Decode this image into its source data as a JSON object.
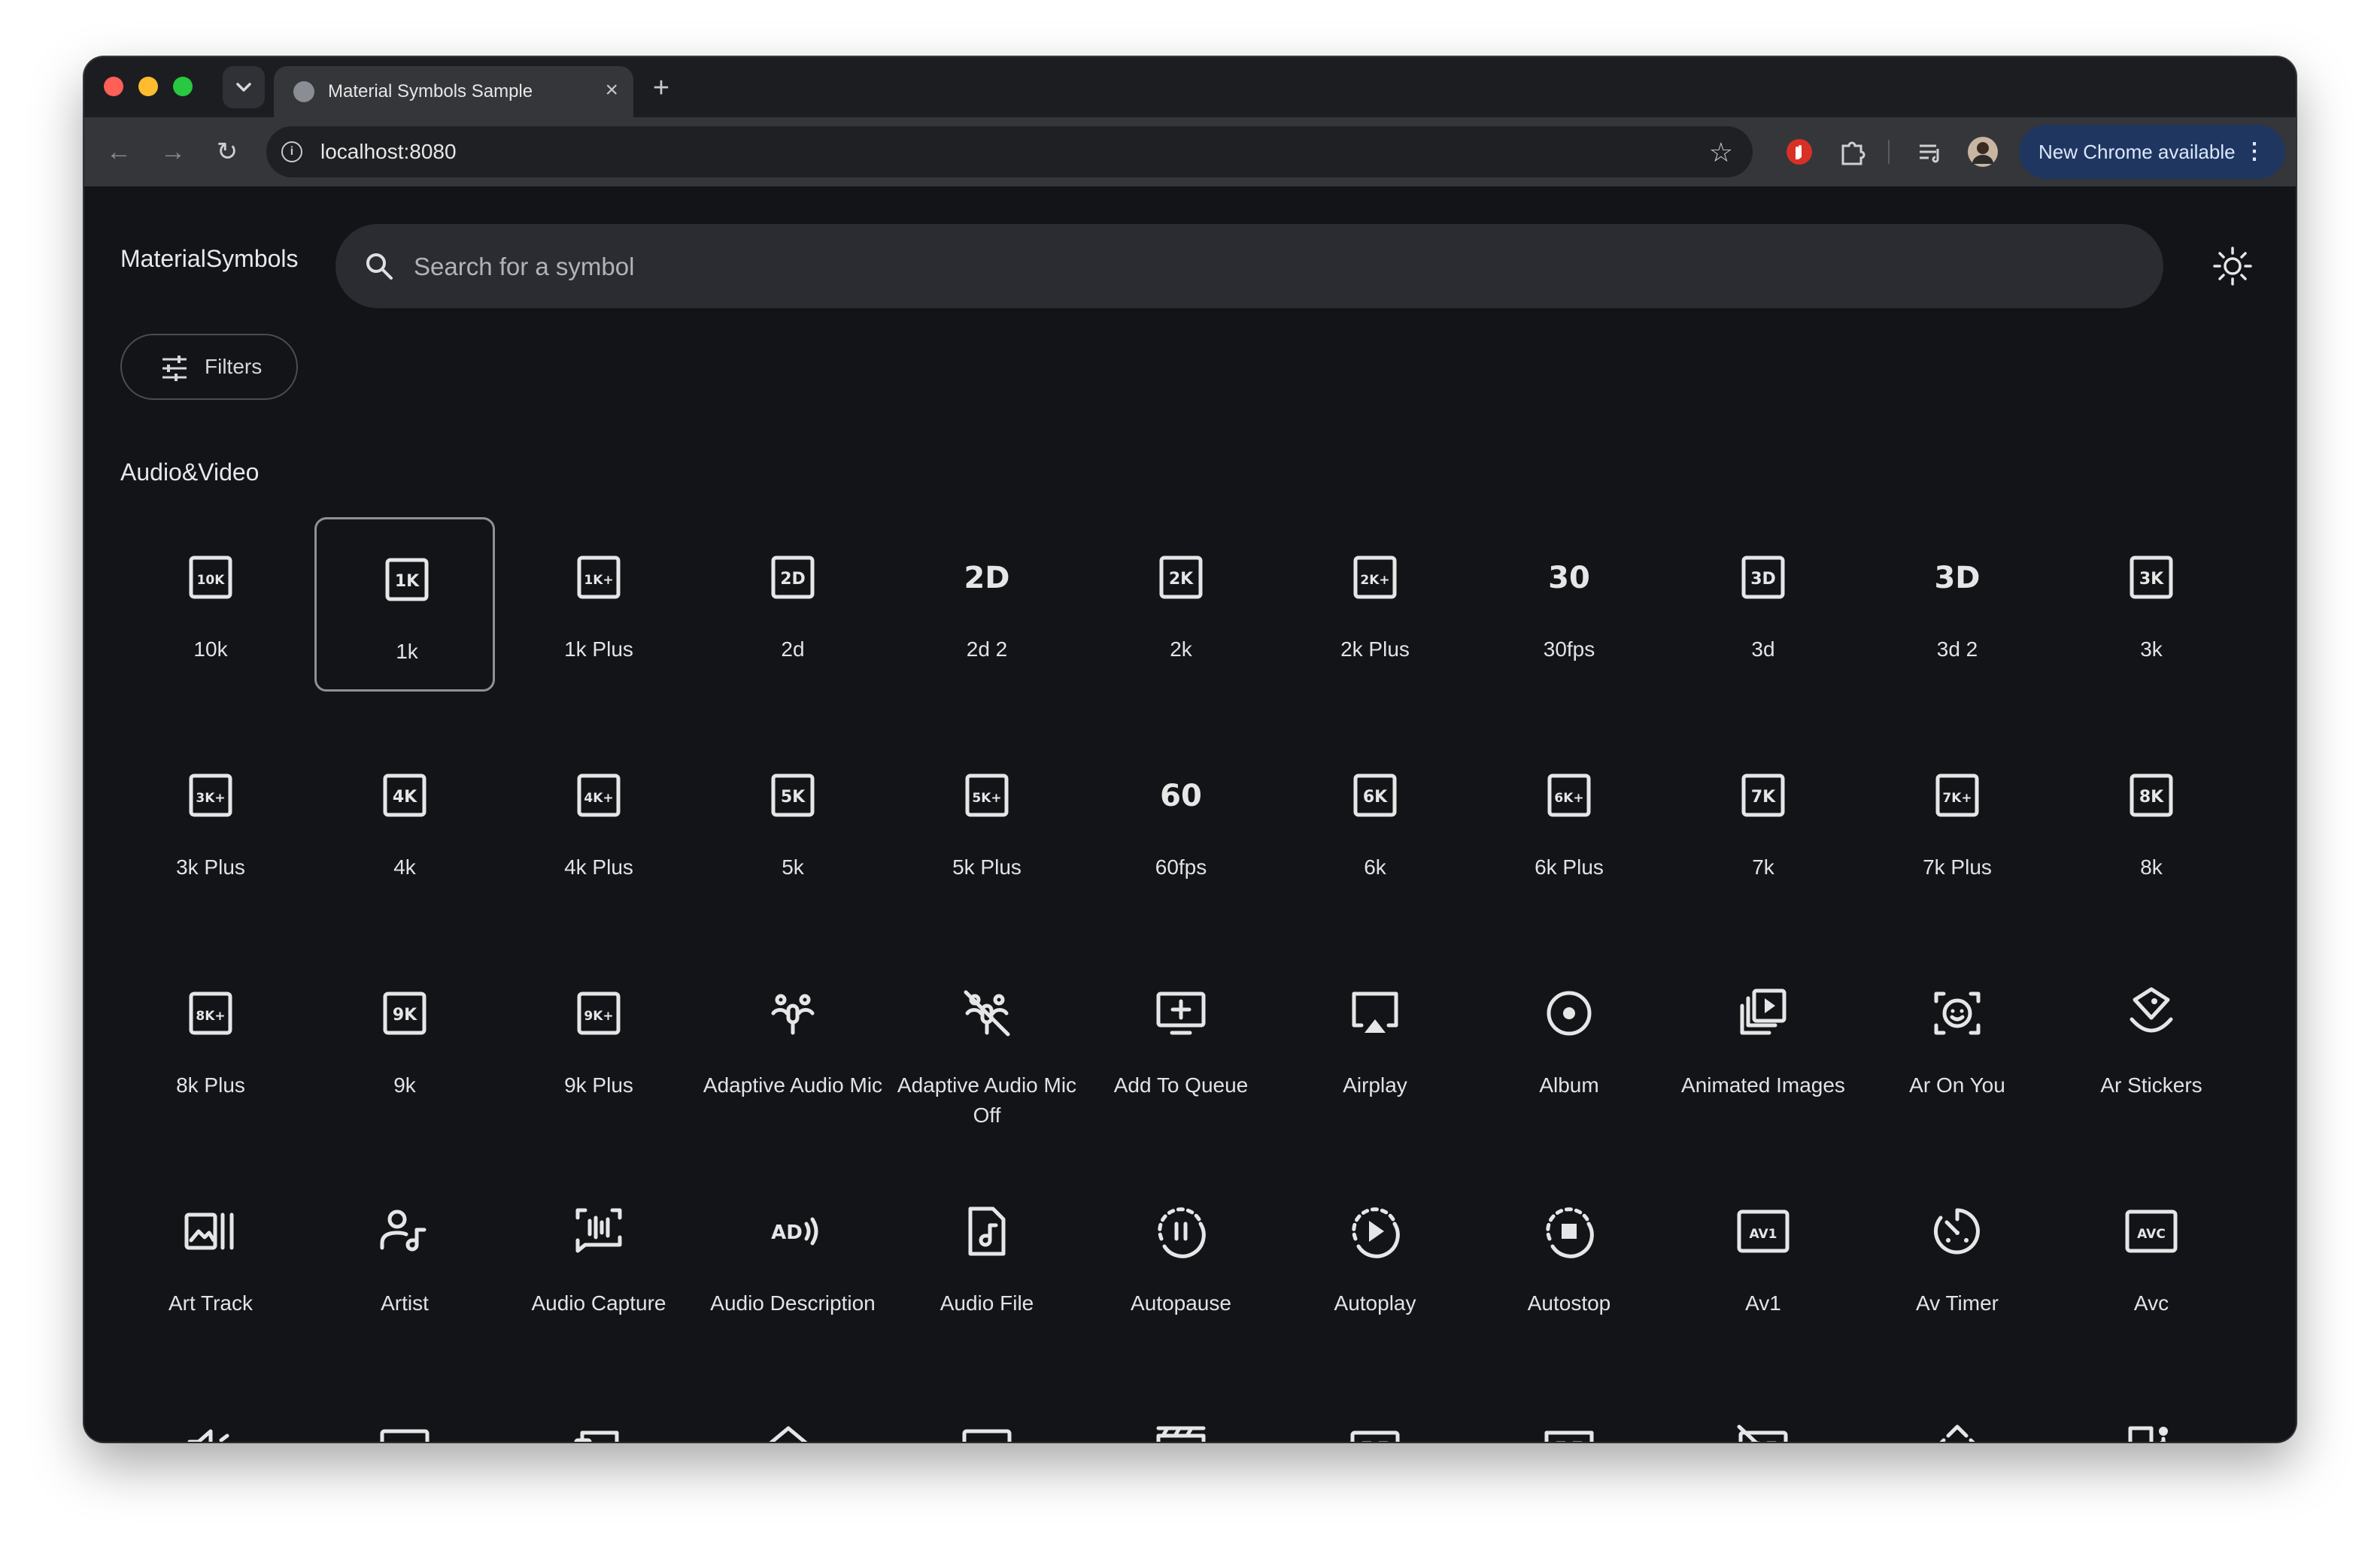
{
  "browser": {
    "tab_title": "Material Symbols Sample",
    "tab_close": "×",
    "new_tab": "+",
    "url": "localhost:8080",
    "update_label": "New Chrome available",
    "update_menu": "⋮",
    "nav_back": "←",
    "nav_forward": "→",
    "nav_reload": "↻",
    "bookmark_star": "☆"
  },
  "app": {
    "brand": "MaterialSymbols",
    "search_placeholder": "Search for a symbol",
    "filters_label": "Filters",
    "section_title": "Audio&Video",
    "selected_icon": "1k"
  },
  "icons": [
    {
      "label": "10k",
      "glyph": "10K",
      "kind": "box"
    },
    {
      "label": "1k",
      "glyph": "1K",
      "kind": "box"
    },
    {
      "label": "1k Plus",
      "glyph": "1K+",
      "kind": "box"
    },
    {
      "label": "2d",
      "glyph": "2D",
      "kind": "box"
    },
    {
      "label": "2d 2",
      "glyph": "2D",
      "kind": "text"
    },
    {
      "label": "2k",
      "glyph": "2K",
      "kind": "box"
    },
    {
      "label": "2k Plus",
      "glyph": "2K+",
      "kind": "box"
    },
    {
      "label": "30fps",
      "glyph": "30",
      "kind": "text"
    },
    {
      "label": "3d",
      "glyph": "3D",
      "kind": "box"
    },
    {
      "label": "3d 2",
      "glyph": "3D",
      "kind": "text"
    },
    {
      "label": "3k",
      "glyph": "3K",
      "kind": "box"
    },
    {
      "label": "3k Plus",
      "glyph": "3K+",
      "kind": "box"
    },
    {
      "label": "4k",
      "glyph": "4K",
      "kind": "box"
    },
    {
      "label": "4k Plus",
      "glyph": "4K+",
      "kind": "box"
    },
    {
      "label": "5k",
      "glyph": "5K",
      "kind": "box"
    },
    {
      "label": "5k Plus",
      "glyph": "5K+",
      "kind": "box"
    },
    {
      "label": "60fps",
      "glyph": "60",
      "kind": "text"
    },
    {
      "label": "6k",
      "glyph": "6K",
      "kind": "box"
    },
    {
      "label": "6k Plus",
      "glyph": "6K+",
      "kind": "box"
    },
    {
      "label": "7k",
      "glyph": "7K",
      "kind": "box"
    },
    {
      "label": "7k Plus",
      "glyph": "7K+",
      "kind": "box"
    },
    {
      "label": "8k",
      "glyph": "8K",
      "kind": "box"
    },
    {
      "label": "8k Plus",
      "glyph": "8K+",
      "kind": "box"
    },
    {
      "label": "9k",
      "glyph": "9K",
      "kind": "box"
    },
    {
      "label": "9k Plus",
      "glyph": "9K+",
      "kind": "box"
    },
    {
      "label": "Adaptive Audio Mic",
      "kind": "mic"
    },
    {
      "label": "Adaptive Audio Mic Off",
      "kind": "mic-off"
    },
    {
      "label": "Add To Queue",
      "kind": "queue"
    },
    {
      "label": "Airplay",
      "kind": "airplay"
    },
    {
      "label": "Album",
      "kind": "album"
    },
    {
      "label": "Animated Images",
      "kind": "animated"
    },
    {
      "label": "Ar On You",
      "kind": "face"
    },
    {
      "label": "Ar Stickers",
      "kind": "sticker"
    },
    {
      "label": "Art Track",
      "kind": "art-track"
    },
    {
      "label": "Artist",
      "kind": "artist"
    },
    {
      "label": "Audio Capture",
      "kind": "capture"
    },
    {
      "label": "Audio Description",
      "glyph": "AD",
      "kind": "ad"
    },
    {
      "label": "Audio File",
      "kind": "audio-file"
    },
    {
      "label": "Autopause",
      "kind": "autopause"
    },
    {
      "label": "Autoplay",
      "kind": "autoplay"
    },
    {
      "label": "Autostop",
      "kind": "autostop"
    },
    {
      "label": "Av1",
      "glyph": "AV1",
      "kind": "wide-box"
    },
    {
      "label": "Av Timer",
      "kind": "timer"
    },
    {
      "label": "Avc",
      "glyph": "AVC",
      "kind": "wide-box"
    },
    {
      "label": "",
      "kind": "volume"
    },
    {
      "label": "",
      "kind": "pip"
    },
    {
      "label": "",
      "kind": "devices-wifi"
    },
    {
      "label": "",
      "kind": "home-wifi"
    },
    {
      "label": "",
      "kind": "bottom-bar"
    },
    {
      "label": "",
      "kind": "clapper"
    },
    {
      "label": "",
      "kind": "cc"
    },
    {
      "label": "",
      "kind": "cc-add"
    },
    {
      "label": "",
      "kind": "cc-off"
    },
    {
      "label": "",
      "kind": "control-camera"
    },
    {
      "label": "",
      "kind": "door-person"
    }
  ],
  "colors": {
    "page_bg": "#121418",
    "icon": "#e6e6e6",
    "search_bg": "#2a2c31",
    "update_bg": "#1f3660",
    "selected_border": "#8e9197"
  }
}
